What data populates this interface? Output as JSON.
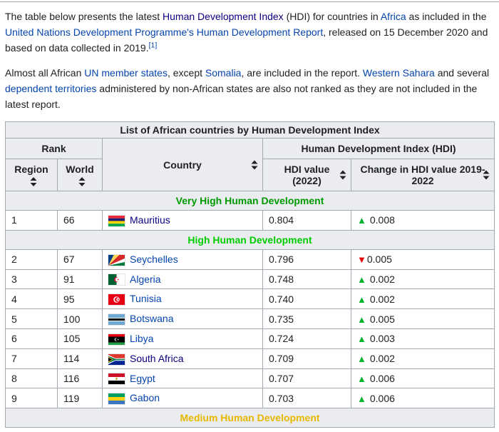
{
  "colors": {
    "link": "#0645ad",
    "visited_link": "#0b0080",
    "increase": "#00b32c",
    "decrease": "#e30000",
    "table_border": "#a2a9b1",
    "header_background": "#eaecf0"
  },
  "paragraphs": [
    {
      "segments": [
        {
          "text": "The table below presents the latest "
        },
        {
          "text": "Human Development Index",
          "link": true,
          "visited": true
        },
        {
          "text": " (HDI) for countries in "
        },
        {
          "text": "Africa",
          "link": true
        },
        {
          "text": " as included in the "
        },
        {
          "text": "United Nations Development Programme's Human Development Report",
          "link": true
        },
        {
          "text": ", released on 15 December 2020 and based on data collected in 2019."
        },
        {
          "text": "[1]",
          "link": true,
          "sup": true
        }
      ]
    },
    {
      "segments": [
        {
          "text": "Almost all African "
        },
        {
          "text": "UN member states",
          "link": true
        },
        {
          "text": ", except "
        },
        {
          "text": "Somalia",
          "link": true
        },
        {
          "text": ", are included in the report. "
        },
        {
          "text": "Western Sahara",
          "link": true
        },
        {
          "text": " and several "
        },
        {
          "text": "dependent territories",
          "link": true
        },
        {
          "text": " administered by non-African states are also not ranked as they are not included in the latest report."
        }
      ]
    }
  ],
  "table": {
    "title": "List of African countries by Human Development Index",
    "headers": {
      "rank": "Rank",
      "country": "Country",
      "hdi_group": "Human Development Index (HDI)",
      "region": "Region",
      "world": "World",
      "hdi_value": "HDI value (2022)",
      "change": "Change in HDI value 2019-2022"
    },
    "sections": [
      {
        "label": "Very High Human Development",
        "color": "#009900",
        "rows": [
          {
            "region": "1",
            "world": "66",
            "country": "Mauritius",
            "flag": "mauritius",
            "visited": true,
            "hdi": "0.804",
            "change": {
              "dir": "up",
              "value": "0.008"
            }
          }
        ]
      },
      {
        "label": "High Human Development",
        "color": "#00cc00",
        "rows": [
          {
            "region": "2",
            "world": "67",
            "country": "Seychelles",
            "flag": "seychelles",
            "hdi": "0.796",
            "change": {
              "dir": "down",
              "value": "0.005"
            }
          },
          {
            "region": "3",
            "world": "91",
            "country": "Algeria",
            "flag": "algeria",
            "hdi": "0.748",
            "change": {
              "dir": "up",
              "value": "0.002"
            }
          },
          {
            "region": "4",
            "world": "95",
            "country": "Tunisia",
            "flag": "tunisia",
            "hdi": "0.740",
            "change": {
              "dir": "up",
              "value": "0.002"
            }
          },
          {
            "region": "5",
            "world": "100",
            "country": "Botswana",
            "flag": "botswana",
            "hdi": "0.735",
            "change": {
              "dir": "up",
              "value": "0.005"
            }
          },
          {
            "region": "6",
            "world": "105",
            "country": "Libya",
            "flag": "libya",
            "hdi": "0.724",
            "change": {
              "dir": "up",
              "value": "0.003"
            }
          },
          {
            "region": "7",
            "world": "114",
            "country": "South Africa",
            "flag": "south-africa",
            "visited": true,
            "hdi": "0.709",
            "change": {
              "dir": "up",
              "value": "0.002"
            }
          },
          {
            "region": "8",
            "world": "116",
            "country": "Egypt",
            "flag": "egypt",
            "hdi": "0.707",
            "change": {
              "dir": "up",
              "value": "0.006"
            }
          },
          {
            "region": "9",
            "world": "119",
            "country": "Gabon",
            "flag": "gabon",
            "hdi": "0.703",
            "change": {
              "dir": "up",
              "value": "0.006"
            }
          }
        ]
      },
      {
        "label": "Medium Human Development",
        "color": "#e6b800",
        "rows": []
      }
    ]
  }
}
